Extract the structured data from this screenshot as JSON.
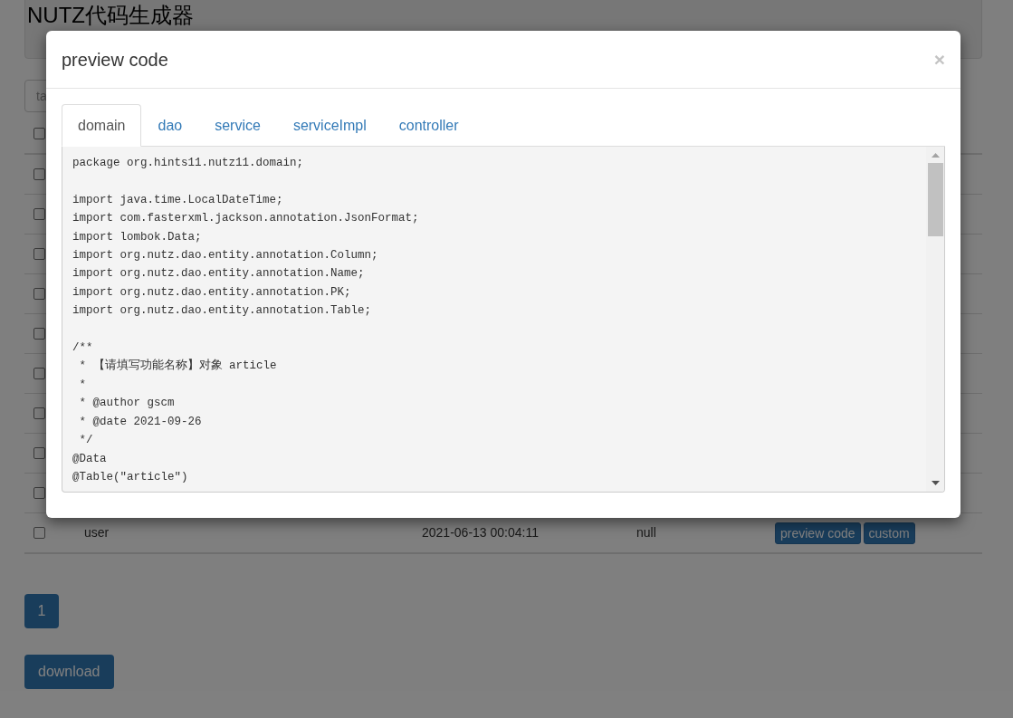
{
  "page": {
    "title": "NUTZ代码生成器",
    "search": {
      "placeholder": "ta"
    },
    "table": {
      "header_checkbox": {
        "checked": false
      },
      "rows": [
        {
          "checked": false
        },
        {
          "checked": false
        },
        {
          "checked": false
        },
        {
          "checked": false
        },
        {
          "checked": false
        },
        {
          "checked": false
        },
        {
          "checked": false
        },
        {
          "checked": false
        },
        {
          "checked": false
        },
        {
          "checked": false,
          "name": "user",
          "created": "2021-06-13 00:04:11",
          "comment": "null",
          "actions": [
            "preview code",
            "custom"
          ]
        }
      ]
    },
    "pagination": [
      {
        "label": "1",
        "selected": true
      }
    ],
    "download_button": "download"
  },
  "modal": {
    "title": "preview code",
    "close": "×",
    "tabs": [
      {
        "label": "domain",
        "selected": true
      },
      {
        "label": "dao",
        "selected": false
      },
      {
        "label": "service",
        "selected": false
      },
      {
        "label": "serviceImpl",
        "selected": false
      },
      {
        "label": "controller",
        "selected": false
      }
    ],
    "code": "package org.hints11.nutz11.domain;\n\nimport java.time.LocalDateTime;\nimport com.fasterxml.jackson.annotation.JsonFormat;\nimport lombok.Data;\nimport org.nutz.dao.entity.annotation.Column;\nimport org.nutz.dao.entity.annotation.Name;\nimport org.nutz.dao.entity.annotation.PK;\nimport org.nutz.dao.entity.annotation.Table;\n\n/**\n * 【请填写功能名称】对象 article\n *\n * @author gscm\n * @date 2021-09-26\n */\n@Data\n@Table(\"article\")"
  }
}
